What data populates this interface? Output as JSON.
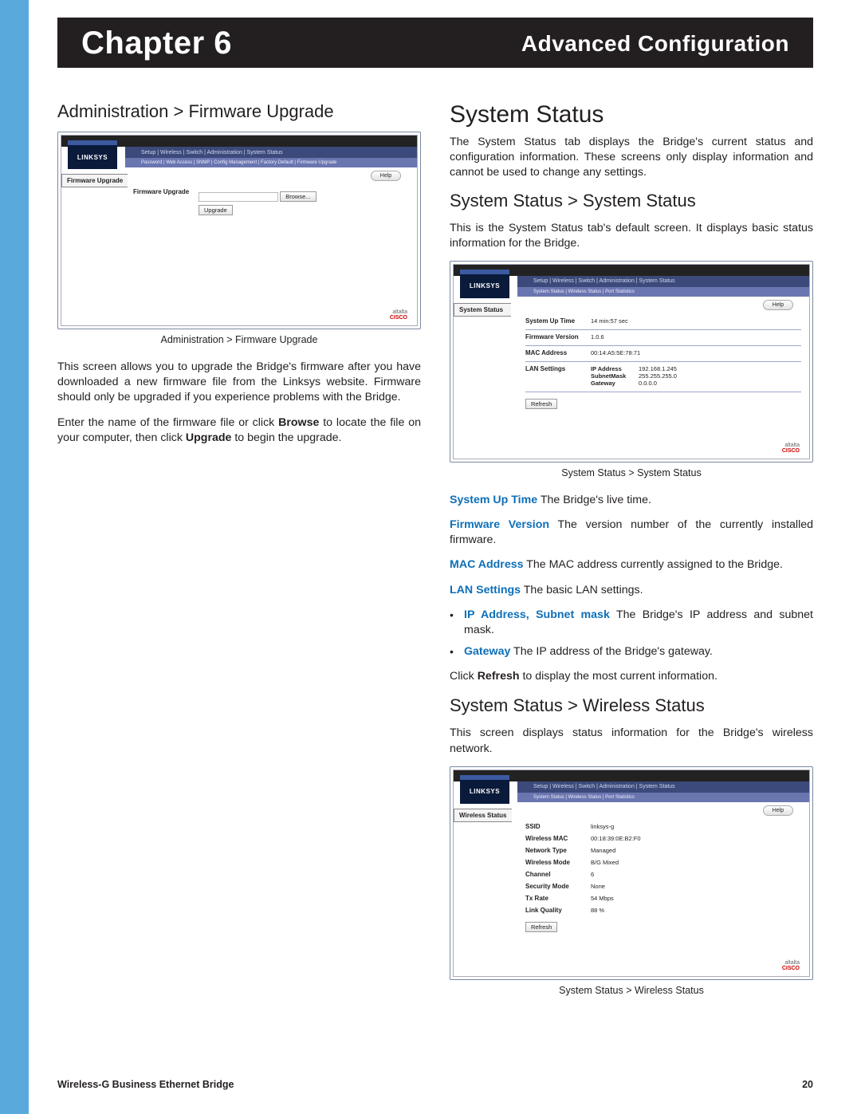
{
  "header": {
    "chapter": "Chapter 6",
    "title": "Advanced Configuration"
  },
  "left": {
    "heading": "Administration > Firmware Upgrade",
    "shot": {
      "logo": "LINKSYS",
      "tabs": "Setup | Wireless | Switch | Administration | System Status",
      "sub": "Password | Web Access | SNMP | Config Management | Factory Default | Firmware Upgrade",
      "sidetab": "Firmware Upgrade",
      "help": "Help",
      "rowlabel": "Firmware Upgrade",
      "browse": "Browse...",
      "upgrade": "Upgrade",
      "cisco1": "altalta",
      "cisco2": "CISCO"
    },
    "caption": "Administration > Firmware Upgrade",
    "p1a": "This screen allows you to upgrade the Bridge's firmware after you have downloaded a new firmware file from the Linksys website. Firmware should only be upgraded if you experience problems with the Bridge.",
    "p2_pre": "Enter the name of the firmware file or click ",
    "p2_b1": "Browse",
    "p2_mid": " to locate the file on your computer, then click ",
    "p2_b2": "Upgrade",
    "p2_post": " to begin the upgrade."
  },
  "right": {
    "h1": "System Status",
    "intro": "The System Status tab displays the Bridge's current status and configuration information. These screens only display information and cannot be used to change any settings.",
    "h2a": "System Status > System Status",
    "p_a": "This is the System Status tab's default screen. It displays basic status information for the Bridge.",
    "shot1": {
      "logo": "LINKSYS",
      "tabs": "Setup | Wireless | Switch | Administration | System Status",
      "sub": "System Status | Wireless Status | Port Statistics",
      "sidetab": "System Status",
      "help": "Help",
      "r1l": "System Up Time",
      "r1v": "14 min:57 sec",
      "r2l": "Firmware Version",
      "r2v": "1.0.6",
      "r3l": "MAC Address",
      "r3v": "00:14:A5:5E:78:71",
      "r4l": "LAN Settings",
      "ip_l": "IP Address",
      "ip_v": "192.168.1.245",
      "sm_l": "SubnetMask",
      "sm_v": "255.255.255.0",
      "gw_l": "Gateway",
      "gw_v": "0.0.0.0",
      "refresh": "Refresh",
      "cisco1": "altalta",
      "cisco2": "CISCO"
    },
    "caption1": "System Status > System Status",
    "sut": "System Up Time",
    "sut_t": "  The Bridge's live time.",
    "fv": "Firmware Version",
    "fv_t": "  The version number of the currently installed firmware.",
    "mac": "MAC Address",
    "mac_t": "  The MAC address currently assigned to the Bridge.",
    "lan": "LAN Settings",
    "lan_t": "  The basic LAN settings.",
    "b1": "IP Address, Subnet mask",
    "b1_t": "  The Bridge's IP address and subnet mask.",
    "b2": "Gateway",
    "b2_t": "  The IP address of the Bridge's gateway.",
    "click_pre": "Click ",
    "click_b": "Refresh",
    "click_post": " to display the most current information.",
    "h2b": "System Status > Wireless Status",
    "p_b": "This screen displays status information for the Bridge's wireless network.",
    "shot2": {
      "logo": "LINKSYS",
      "tabs": "Setup | Wireless | Switch | Administration | System Status",
      "sub": "System Status | Wireless Status | Port Statistics",
      "sidetab": "Wireless Status",
      "help": "Help",
      "r1l": "SSID",
      "r1v": "linksys-g",
      "r2l": "Wireless MAC",
      "r2v": "00:18:39:0E:B2:F0",
      "r3l": "Network Type",
      "r3v": "Managed",
      "r4l": "Wireless Mode",
      "r4v": "B/G Mixed",
      "r5l": "Channel",
      "r5v": "6",
      "r6l": "Security Mode",
      "r6v": "None",
      "r7l": "Tx Rate",
      "r7v": "54 Mbps",
      "r8l": "Link Quality",
      "r8v": "88 %",
      "refresh": "Refresh",
      "cisco1": "altalta",
      "cisco2": "CISCO"
    },
    "caption2": "System Status > Wireless Status"
  },
  "footer": {
    "product": "Wireless-G Business Ethernet Bridge",
    "page": "20"
  }
}
